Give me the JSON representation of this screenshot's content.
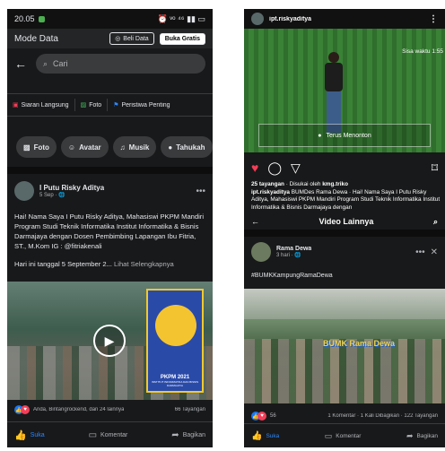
{
  "left": {
    "status": {
      "time": "20.05",
      "right": "⏰ ᵛᵒ  ⁴⁶ ▮▮ ▭"
    },
    "mode_bar": {
      "title": "Mode Data",
      "buy_label": "Beli Data",
      "free_label": "Buka Gratis"
    },
    "search": {
      "placeholder": "Cari"
    },
    "composer": [
      {
        "icon": "live-icon",
        "label": "Siaran Langsung"
      },
      {
        "icon": "photo-icon",
        "label": "Foto"
      },
      {
        "icon": "flag-icon",
        "label": "Peristiwa Penting"
      }
    ],
    "chips": [
      {
        "icon": "photo-icon",
        "label": "Foto"
      },
      {
        "icon": "avatar-icon",
        "label": "Avatar"
      },
      {
        "icon": "music-icon",
        "label": "Musik"
      },
      {
        "icon": "comment-icon",
        "label": "Tahukah"
      }
    ],
    "post": {
      "author": "I Putu Risky Aditya",
      "meta": "5 Sep · 🌐",
      "body_1": "Hai! Nama Saya I Putu Risky Aditya, Mahasiswi PKPM Mandiri Program Studi Teknik Informatika Institut Informatika & Bisnis Darmajaya dengan Dosen Pembimbing Lapangan Ibu Fitria, ST., M.Kom IG : @fitriakenali",
      "body_2": "Hari ini tanggal 5 September 2...",
      "see_more": "Lihat Selengkapnya",
      "poster_title": "PKPM 2021",
      "poster_sub": "INSTITUT INFORMATIKA DAN BISNIS DARMAJAYA",
      "reactions_text": "Anda, Bintangrockend, dan 24 lainnya",
      "views": "66 Tayangan",
      "actions": {
        "like": "Suka",
        "comment": "Komentar",
        "share": "Bagikan"
      }
    }
  },
  "right": {
    "ig": {
      "username": "ipt.riskyaditya",
      "remaining": "Sisa waktu 1:55",
      "continue_label": "Terus Menonton",
      "likes": "25 tayangan",
      "liked_by_prefix": " · Disukai oleh ",
      "liked_by": "kmg.triko",
      "caption_user": "ipt.riskyaditya",
      "caption_text": " BUMDes Rama Dewa · Hai! Nama Saya I Putu Risky Aditya, Mahasiswi PKPM Mandiri Program Studi Teknik Informatika Institut Informatika & Bisnis Darmajaya dengan"
    },
    "video_bar": {
      "title": "Video Lainnya"
    },
    "post": {
      "author": "Rama Dewa",
      "meta": "3 hari · 🌐",
      "hashtag": "#BUMKKampungRamaDewa",
      "sign_text": "BUMK Rama Dewa",
      "reaction_count": "56",
      "stats": "1 Komentar · 1 Kali Dibagikan · 122 Tayangan",
      "actions": {
        "like": "Suka",
        "comment": "Komentar",
        "share": "Bagikan"
      }
    }
  },
  "colors": {
    "fb_dark": "#18191a",
    "fb_blue": "#2d88ff",
    "ig_green": "#3a8236",
    "heart": "#f33e58"
  }
}
